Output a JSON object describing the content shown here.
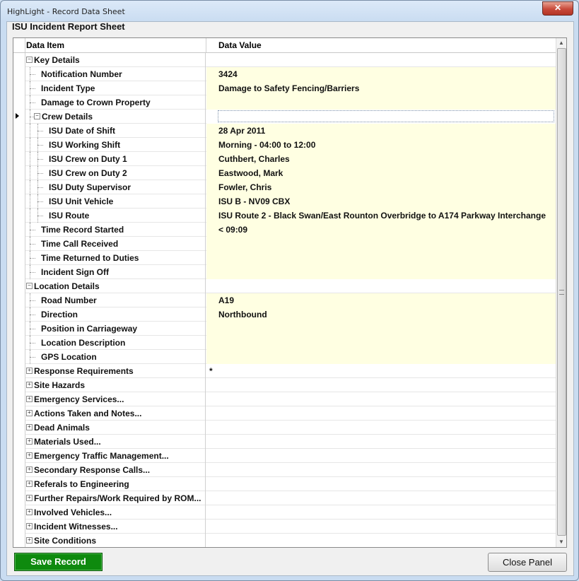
{
  "window": {
    "title": "HighLight - Record Data Sheet",
    "close_glyph": "✕"
  },
  "panel": {
    "title": "ISU Incident Report Sheet"
  },
  "grid": {
    "headers": {
      "item": "Data Item",
      "value": "Data Value"
    },
    "rows": [
      {
        "level": 0,
        "type": "group",
        "expanded": true,
        "label": "Key Details",
        "value": "",
        "filled": false
      },
      {
        "level": 1,
        "type": "field",
        "label": "Notification Number",
        "value": "3424",
        "filled": true
      },
      {
        "level": 1,
        "type": "field",
        "label": "Incident Type",
        "value": "Damage to Safety Fencing/Barriers",
        "filled": true
      },
      {
        "level": 1,
        "type": "field",
        "label": "Damage to Crown Property",
        "value": "",
        "filled": true
      },
      {
        "level": 1,
        "type": "group",
        "expanded": true,
        "label": "Crew Details",
        "value": "",
        "filled": false,
        "current": true
      },
      {
        "level": 2,
        "type": "field",
        "label": "ISU Date of Shift",
        "value": "28 Apr 2011",
        "filled": true
      },
      {
        "level": 2,
        "type": "field",
        "label": "ISU Working Shift",
        "value": "Morning - 04:00 to 12:00",
        "filled": true
      },
      {
        "level": 2,
        "type": "field",
        "label": "ISU Crew on Duty 1",
        "value": "Cuthbert, Charles",
        "filled": true
      },
      {
        "level": 2,
        "type": "field",
        "label": "ISU Crew on Duty 2",
        "value": "Eastwood, Mark",
        "filled": true
      },
      {
        "level": 2,
        "type": "field",
        "label": "ISU Duty Supervisor",
        "value": "Fowler, Chris",
        "filled": true
      },
      {
        "level": 2,
        "type": "field",
        "label": "ISU Unit Vehicle",
        "value": "ISU B - NV09 CBX",
        "filled": true
      },
      {
        "level": 2,
        "type": "field",
        "label": "ISU Route",
        "value": "ISU Route 2 - Black Swan/East Rounton Overbridge to A174 Parkway Interchange",
        "filled": true
      },
      {
        "level": 1,
        "type": "field",
        "label": "Time Record Started",
        "value": "< 09:09",
        "filled": true
      },
      {
        "level": 1,
        "type": "field",
        "label": "Time Call Received",
        "value": "",
        "filled": true
      },
      {
        "level": 1,
        "type": "field",
        "label": "Time Returned to Duties",
        "value": "",
        "filled": true
      },
      {
        "level": 1,
        "type": "field",
        "label": "Incident Sign Off",
        "value": "",
        "filled": true
      },
      {
        "level": 0,
        "type": "group",
        "expanded": true,
        "label": "Location Details",
        "value": "",
        "filled": false
      },
      {
        "level": 1,
        "type": "field",
        "label": "Road Number",
        "value": "A19",
        "filled": true
      },
      {
        "level": 1,
        "type": "field",
        "label": "Direction",
        "value": "Northbound",
        "filled": true
      },
      {
        "level": 1,
        "type": "field",
        "label": "Position in Carriageway",
        "value": "",
        "filled": true
      },
      {
        "level": 1,
        "type": "field",
        "label": "Location Description",
        "value": "",
        "filled": true
      },
      {
        "level": 1,
        "type": "field",
        "label": "GPS Location",
        "value": "",
        "filled": true
      },
      {
        "level": 0,
        "type": "group",
        "expanded": false,
        "label": "Response Requirements",
        "value": "",
        "filled": false,
        "marker": "*"
      },
      {
        "level": 0,
        "type": "group",
        "expanded": false,
        "label": "Site Hazards",
        "value": "",
        "filled": false
      },
      {
        "level": 0,
        "type": "group",
        "expanded": false,
        "label": "Emergency Services...",
        "value": "",
        "filled": false
      },
      {
        "level": 0,
        "type": "group",
        "expanded": false,
        "label": "Actions Taken and Notes...",
        "value": "",
        "filled": false
      },
      {
        "level": 0,
        "type": "group",
        "expanded": false,
        "label": "Dead Animals",
        "value": "",
        "filled": false
      },
      {
        "level": 0,
        "type": "group",
        "expanded": false,
        "label": "Materials Used...",
        "value": "",
        "filled": false
      },
      {
        "level": 0,
        "type": "group",
        "expanded": false,
        "label": "Emergency Traffic Management...",
        "value": "",
        "filled": false
      },
      {
        "level": 0,
        "type": "group",
        "expanded": false,
        "label": "Secondary Response Calls...",
        "value": "",
        "filled": false
      },
      {
        "level": 0,
        "type": "group",
        "expanded": false,
        "label": "Referals to Engineering",
        "value": "",
        "filled": false
      },
      {
        "level": 0,
        "type": "group",
        "expanded": false,
        "label": "Further Repairs/Work Required by ROM...",
        "value": "",
        "filled": false
      },
      {
        "level": 0,
        "type": "group",
        "expanded": false,
        "label": "Involved Vehicles...",
        "value": "",
        "filled": false
      },
      {
        "level": 0,
        "type": "group",
        "expanded": false,
        "label": "Incident Witnesses...",
        "value": "",
        "filled": false
      },
      {
        "level": 0,
        "type": "group",
        "expanded": false,
        "label": "Site Conditions",
        "value": "",
        "filled": false
      }
    ]
  },
  "scrollbar": {
    "up_glyph": "▲",
    "down_glyph": "▼"
  },
  "buttons": {
    "save": "Save Record",
    "close_panel": "Close Panel"
  },
  "colors": {
    "filled_value_bg": "#ffffe2",
    "save_button_bg": "#0e8a0e"
  }
}
